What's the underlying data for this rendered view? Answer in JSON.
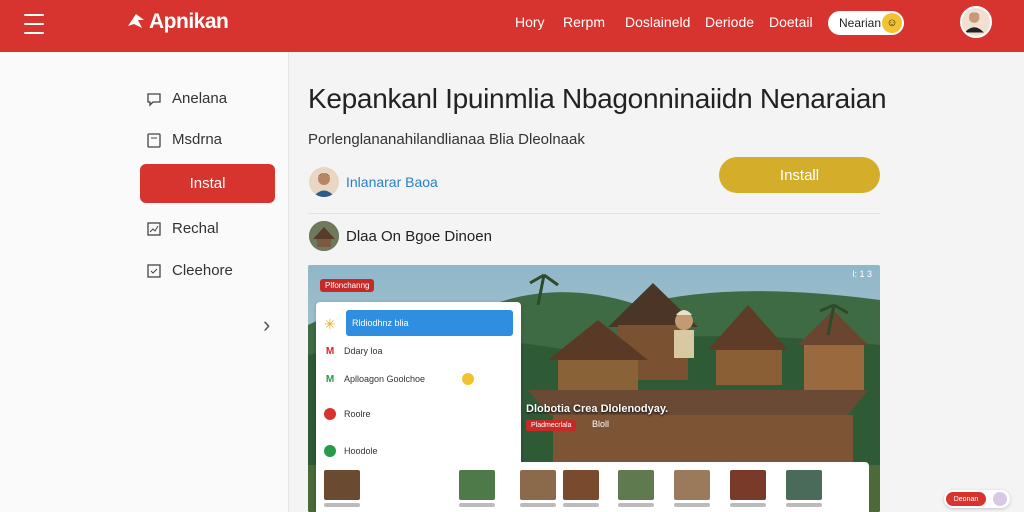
{
  "topbar": {
    "logo_text": "Apnikan",
    "logo_sub": "",
    "nav": [
      "Hory",
      "Rerpm",
      "Doslaineld",
      "Deriode",
      "Doetail"
    ],
    "pill_label": "Nearian",
    "accent_color": "#d8342f"
  },
  "sidebar": {
    "items": [
      {
        "label": "Anelana",
        "icon": "chat-icon"
      },
      {
        "label": "Msdrna",
        "icon": "document-icon"
      },
      {
        "label": "Instal",
        "icon": "",
        "active": true
      },
      {
        "label": "Rechal",
        "icon": "chart-icon"
      },
      {
        "label": "Cleehore",
        "icon": "checkbox-icon"
      }
    ]
  },
  "main": {
    "title": "Kepankanl Ipuinmlia Nbagonninaiidn Nenaraian",
    "subtitle": "Porlenglananahilandlianaa Blia Dleolnaak",
    "author": "Inlanarar Baoa",
    "install_label": "Install",
    "install_color": "#d4ad2a",
    "section_title": "Dlaa On Bgoe Dinoen"
  },
  "media": {
    "status": "l: 1 3",
    "tag": "Plfonchanng",
    "panel_rows": [
      {
        "label": "Rldiodhnz blia",
        "icon": "star-icon",
        "selected": true
      },
      {
        "label": "Ddary loa",
        "icon": "gmail-icon"
      },
      {
        "label": "Aplloagon Goolchoe",
        "icon": "meet-icon"
      },
      {
        "label": "Roolre",
        "icon": "red-dot-icon"
      },
      {
        "label": "Hoodole",
        "icon": "green-dot-icon"
      }
    ],
    "caption": "Dlobotia Crea Dlolenodyay.",
    "chip": "Pladmecrlala",
    "chip2": "Bloll"
  },
  "float": {
    "label": "Deonan"
  }
}
